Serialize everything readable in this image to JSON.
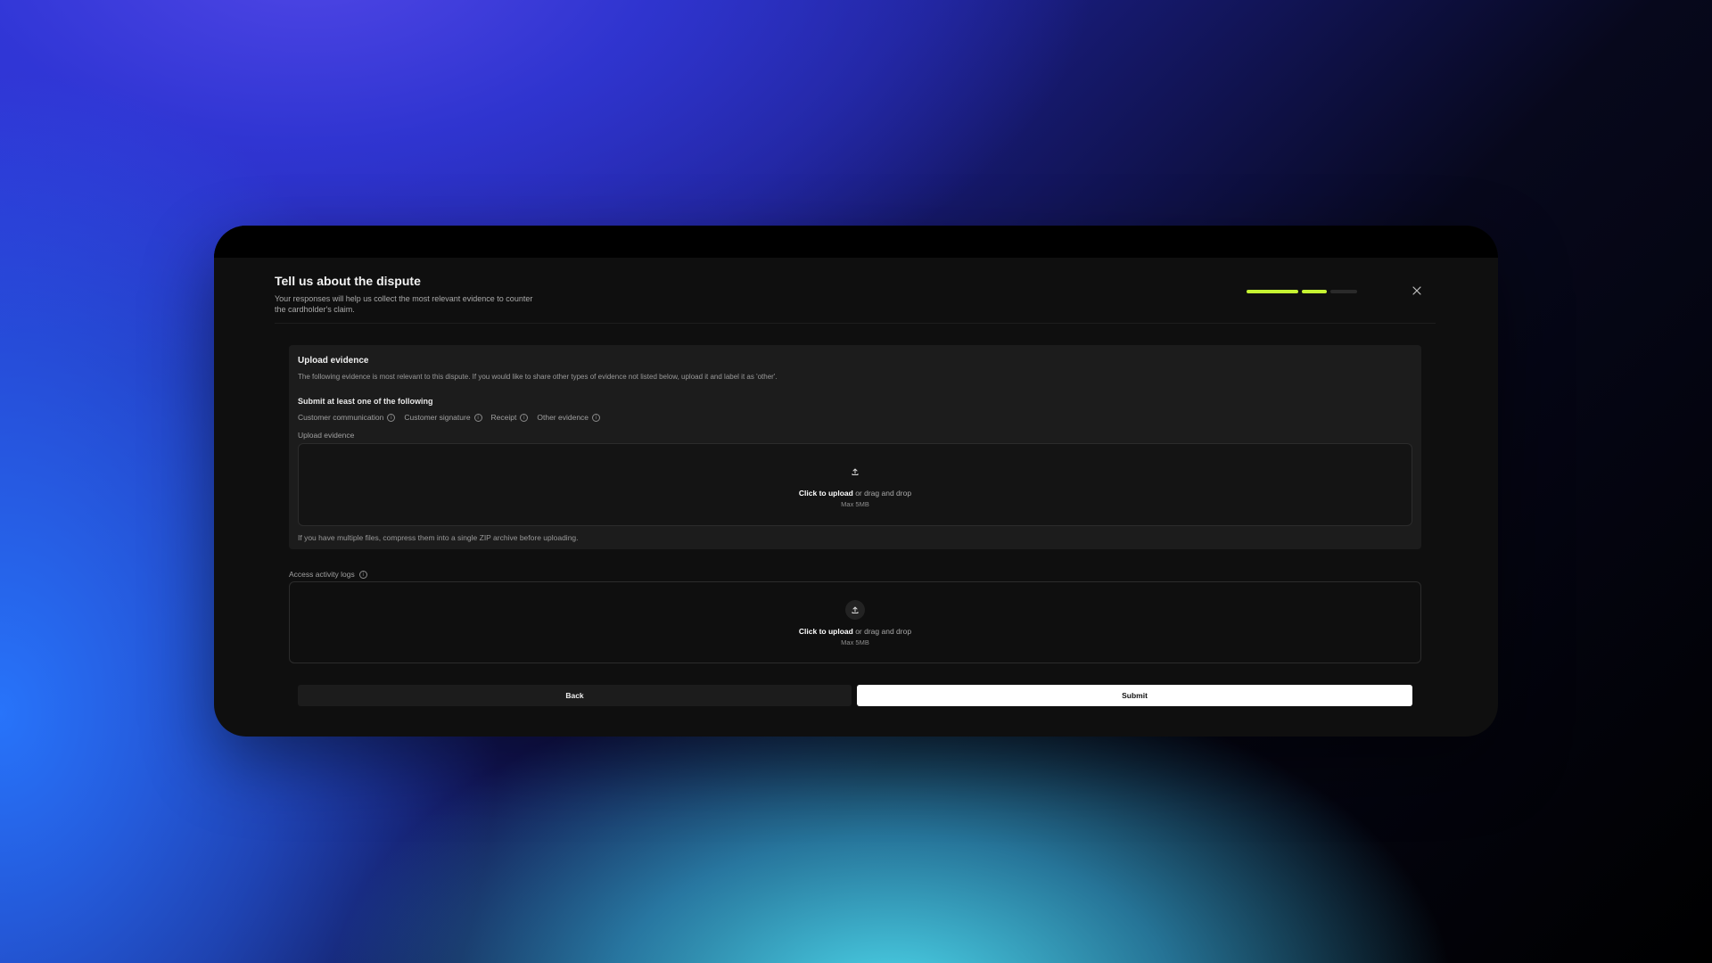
{
  "header": {
    "title": "Tell us about the dispute",
    "subtitle": "Your responses will help us collect the most relevant evidence to counter the cardholder's claim.",
    "close_icon": "close-icon",
    "progress": {
      "steps_total": 3,
      "steps_completed": 2,
      "active_color": "#c6f432",
      "inactive_color": "#2a2a2a"
    }
  },
  "evidence_section": {
    "title": "Upload evidence",
    "description": "The following evidence is most relevant to this dispute. If you would like to share other types of evidence not listed below, upload it and label it as 'other'.",
    "requirement_title": "Submit at least one of the following",
    "requirements": [
      {
        "label": "Customer communication",
        "icon": "info-icon"
      },
      {
        "label": "Customer signature",
        "icon": "info-icon"
      },
      {
        "label": "Receipt",
        "icon": "info-icon"
      },
      {
        "label": "Other evidence",
        "icon": "info-icon"
      }
    ],
    "upload_label": "Upload evidence",
    "upload": {
      "cta": "Click to upload",
      "rest": " or drag and drop",
      "max": "Max 5MB",
      "icon": "upload-icon"
    },
    "hint": "If you have multiple files, compress them into a single ZIP archive before uploading."
  },
  "activity_logs": {
    "label": "Access activity logs",
    "icon": "info-icon",
    "upload": {
      "cta": "Click to upload",
      "rest": " or drag and drop",
      "max": "Max 5MB",
      "icon": "upload-icon"
    }
  },
  "actions": {
    "back_label": "Back",
    "submit_label": "Submit"
  }
}
